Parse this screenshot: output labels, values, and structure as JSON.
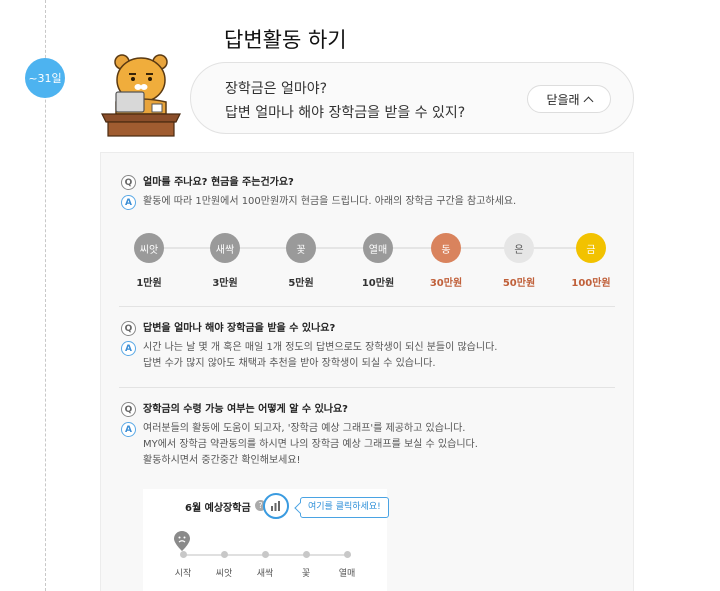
{
  "timeline": {
    "date_badge": "~31일"
  },
  "section": {
    "title": "답변활동 하기"
  },
  "bubble": {
    "line1": "장학금은 얼마야?",
    "line2": "답변 얼마나 해야 장학금을 받을 수 있지?",
    "close_label": "닫을래"
  },
  "faq": [
    {
      "q_icon": "Q",
      "a_icon": "A",
      "question": "얼마를 주나요? 현금을 주는건가요?",
      "answer_lines": [
        "활동에 따라 1만원에서 100만원까지 현금을 드립니다. 아래의 장학금 구간을 참고하세요."
      ]
    },
    {
      "q_icon": "Q",
      "a_icon": "A",
      "question": "답변을 얼마나 해야 장학금을 받을 수 있나요?",
      "answer_lines": [
        "시간 나는 날 몇 개 혹은 매일 1개 정도의 답변으로도 장학생이 되신 분들이 많습니다.",
        "답변 수가 많지 않아도 채택과 추천을 받아 장학생이 되실 수 있습니다."
      ]
    },
    {
      "q_icon": "Q",
      "a_icon": "A",
      "question": "장학금의 수령 가능 여부는 어떻게 알 수 있나요?",
      "answer_lines": [
        "여러분들의 활동에 도움이 되고자, '장학금 예상 그래프'를 제공하고 있습니다.",
        "MY에서 장학금 약관동의를 하시면 나의 장학금 예상 그래프를 보실 수 있습니다.",
        "활동하시면서 중간중간 확인해보세요!"
      ]
    }
  ],
  "levels": [
    {
      "name": "씨앗",
      "amount": "1만원",
      "color": "#9a9a9a",
      "amount_color": "#333333"
    },
    {
      "name": "새싹",
      "amount": "3만원",
      "color": "#9a9a9a",
      "amount_color": "#333333"
    },
    {
      "name": "꽃",
      "amount": "5만원",
      "color": "#9a9a9a",
      "amount_color": "#333333"
    },
    {
      "name": "열매",
      "amount": "10만원",
      "color": "#9a9a9a",
      "amount_color": "#333333"
    },
    {
      "name": "동",
      "amount": "30만원",
      "color": "#d9835d",
      "amount_color": "#c0603a"
    },
    {
      "name": "은",
      "amount": "50만원",
      "color": "#e6e6e6",
      "amount_color": "#c0603a",
      "text_color": "#555555"
    },
    {
      "name": "금",
      "amount": "100만원",
      "color": "#f2c200",
      "amount_color": "#c0603a"
    }
  ],
  "graph": {
    "title": "6월 예상장학금",
    "help": "?",
    "tooltip": "여기를 클릭하세요!",
    "stages": [
      "시작",
      "씨앗",
      "새싹",
      "꽃",
      "열매"
    ]
  },
  "colors": {
    "accent": "#4db3f0",
    "tooltip": "#2d8fd8"
  },
  "icons": {
    "graph_button": "bar-chart-icon",
    "close": "chevron-up-icon",
    "pin": "sad-face-pin-icon"
  }
}
